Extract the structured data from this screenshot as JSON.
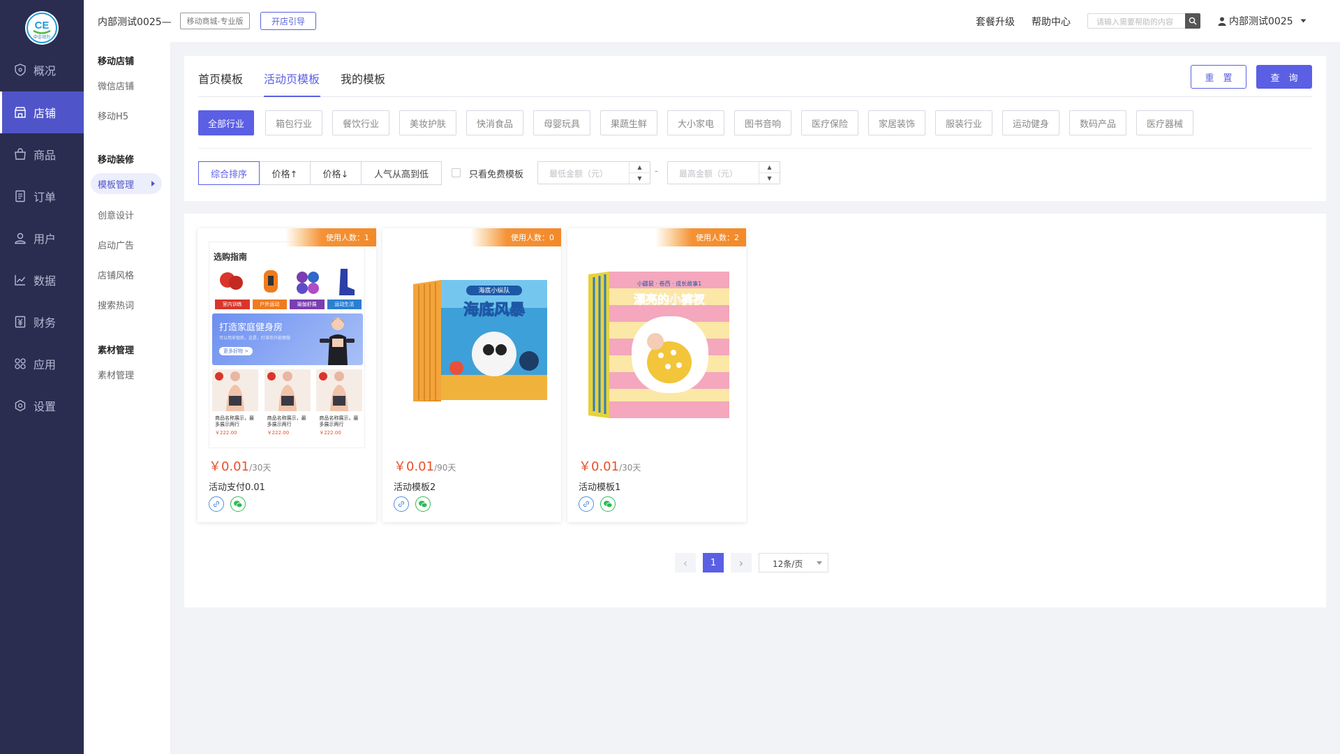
{
  "app": {
    "logo_text": "中企动力"
  },
  "nav": [
    {
      "label": "概况",
      "icon": "overview-icon"
    },
    {
      "label": "店铺",
      "icon": "store-icon",
      "active": true
    },
    {
      "label": "商品",
      "icon": "goods-icon"
    },
    {
      "label": "订单",
      "icon": "order-icon"
    },
    {
      "label": "用户",
      "icon": "user-icon"
    },
    {
      "label": "数据",
      "icon": "data-icon"
    },
    {
      "label": "财务",
      "icon": "finance-icon"
    },
    {
      "label": "应用",
      "icon": "apps-icon"
    },
    {
      "label": "设置",
      "icon": "settings-icon"
    }
  ],
  "subnav": {
    "g1": {
      "title": "移动店铺",
      "items": [
        "微信店铺",
        "移动H5"
      ]
    },
    "g2": {
      "title": "移动装修",
      "items": [
        "模板管理",
        "创意设计",
        "启动广告",
        "店铺风格",
        "搜索热词"
      ]
    },
    "g3": {
      "title": "素材管理",
      "items": [
        "素材管理"
      ]
    }
  },
  "topbar": {
    "store_name": "内部测试0025—",
    "edition": "移动商城-专业版",
    "guide": "开店引导",
    "upgrade": "套餐升级",
    "help": "帮助中心",
    "search_placeholder": "请输入需要帮助的内容",
    "user": "内部测试0025"
  },
  "tabs": [
    "首页模板",
    "活动页模板",
    "我的模板"
  ],
  "actions": {
    "reset": "重　置",
    "query": "查　询"
  },
  "industries": [
    "全部行业",
    "箱包行业",
    "餐饮行业",
    "美妆护肤",
    "快消食品",
    "母婴玩具",
    "果蔬生鲜",
    "大小家电",
    "图书音响",
    "医疗保险",
    "家居装饰",
    "服装行业",
    "运动健身",
    "数码产品",
    "医疗器械"
  ],
  "sorts": [
    "综合排序",
    "价格↑",
    "价格↓",
    "人气从高到低"
  ],
  "filter": {
    "free_only": "只看免费模板",
    "min_placeholder": "最低金额（元）",
    "max_placeholder": "最高金额（元）",
    "dash": "-"
  },
  "templates": [
    {
      "users": "使用人数：1",
      "price": "￥0.01",
      "period": "/30天",
      "name": "活动支付0.01",
      "preview": {
        "title": "选购指南",
        "cats": [
          "室内训练",
          "户外运动",
          "瑜伽舒展",
          "运动生活"
        ],
        "banner": "打造家庭健身房",
        "banner_sub": "可以用来锻炼，这是，盯准你只能哪做",
        "banner_btn": "更多好物 >",
        "goods": "商品名称展示，最多展示两行",
        "goods_price": "￥222.00"
      }
    },
    {
      "users": "使用人数：0",
      "price": "￥0.01",
      "period": "/90天",
      "name": "活动模板2",
      "preview": {
        "book_series": "海底小纵队",
        "book_title": "海底风暴"
      }
    },
    {
      "users": "使用人数：2",
      "price": "￥0.01",
      "period": "/30天",
      "name": "活动模板1",
      "preview": {
        "book_series": "小鼹鼠 · 卷西 · 成长故事1",
        "book_title": "漂亮的小裤衩"
      }
    }
  ],
  "pagination": {
    "prev": "‹",
    "current": "1",
    "next": "›",
    "page_size": "12条/页"
  }
}
